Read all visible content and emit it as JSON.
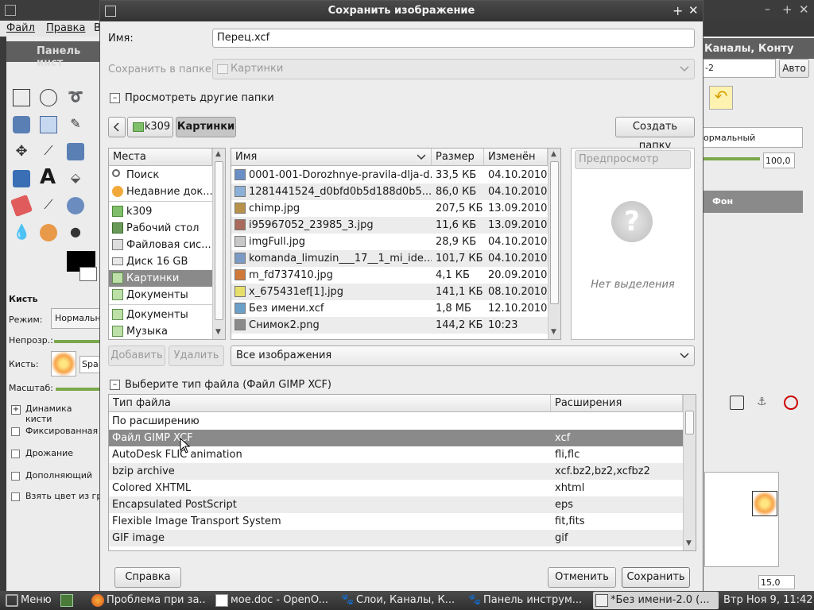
{
  "dialog": {
    "title": "Сохранить изображение",
    "name_label": "Имя:",
    "name_value": "Перец.xcf",
    "save_in_label": "Сохранить в папке",
    "save_in_value": "Картинки",
    "browse_other_label": "Просмотреть другие папки",
    "breadcrumb": [
      "k309",
      "Картинки"
    ],
    "create_folder_label": "Создать папку",
    "places": {
      "header": "Места",
      "items": [
        "Поиск",
        "Недавние док...",
        "k309",
        "Рабочий стол",
        "Файловая сис...",
        "Диск 16 GB",
        "Картинки",
        "Документы",
        "Документы",
        "Музыка"
      ]
    },
    "add_label": "Добавить",
    "remove_label": "Удалить",
    "files": {
      "columns": [
        "Имя",
        "Размер",
        "Изменён"
      ],
      "rows": [
        {
          "name": "0001-001-Dorozhnye-pravila-dlja-d...",
          "size": "33,5 КБ",
          "date": "04.10.2010"
        },
        {
          "name": "1281441524_d0bfd0b5d188d0b5...",
          "size": "86,0 КБ",
          "date": "04.10.2010"
        },
        {
          "name": "chimp.jpg",
          "size": "207,5 КБ",
          "date": "13.09.2010"
        },
        {
          "name": "i95967052_23985_3.jpg",
          "size": "11,6 КБ",
          "date": "13.09.2010"
        },
        {
          "name": "imgFull.jpg",
          "size": "28,9 КБ",
          "date": "04.10.2010"
        },
        {
          "name": "komanda_limuzin___17__1_mi_ide...",
          "size": "101,7 КБ",
          "date": "04.10.2010"
        },
        {
          "name": "m_fd737410.jpg",
          "size": "4,1 КБ",
          "date": "20.09.2010"
        },
        {
          "name": "x_675431ef[1].jpg",
          "size": "141,1 КБ",
          "date": "08.10.2010"
        },
        {
          "name": "Без имени.xcf",
          "size": "1,8 МБ",
          "date": "12.10.2010"
        },
        {
          "name": "Снимок2.png",
          "size": "144,2 КБ",
          "date": "10:23"
        }
      ]
    },
    "preview_label": "Предпросмотр",
    "no_selection": "Нет выделения",
    "filter_value": "Все изображения",
    "filetype_label": "Выберите тип файла (Файл GIMP XCF)",
    "types": {
      "columns": [
        "Тип файла",
        "Расширения"
      ],
      "rows": [
        {
          "type": "По расширению",
          "ext": ""
        },
        {
          "type": "Файл GIMP XCF",
          "ext": "xcf"
        },
        {
          "type": "AutoDesk FLIC animation",
          "ext": "fli,flc"
        },
        {
          "type": "bzip archive",
          "ext": "xcf.bz2,bz2,xcfbz2"
        },
        {
          "type": "Colored XHTML",
          "ext": "xhtml"
        },
        {
          "type": "Encapsulated PostScript",
          "ext": "eps"
        },
        {
          "type": "Flexible Image Transport System",
          "ext": "fit,fits"
        },
        {
          "type": "GIF image",
          "ext": "gif"
        }
      ]
    },
    "help_label": "Справка",
    "cancel_label": "Отменить",
    "save_label": "Сохранить"
  },
  "background": {
    "menu": [
      "Файл",
      "Правка",
      "В"
    ],
    "toolbox_title": "Панель инст",
    "right_title": "Каналы, Конту",
    "auto_label": "Авто",
    "mode_value": "ормальный",
    "opacity_value": "100,0",
    "layer_name": "Фон",
    "size_value": "15,0",
    "brush_label": "Кисть",
    "mode_label": "Режим:",
    "mode_opt": "Нормальн",
    "opacity_label": "Непрозр.:",
    "brush_row_label": "Кисть:",
    "brush_name": "Spa",
    "scale_label": "Масштаб:",
    "options": [
      "Динамика кисти",
      "Фиксированная д",
      "Дрожание",
      "Дополняющий",
      "Взять цвет из гра"
    ]
  },
  "taskbar": {
    "menu_label": "Меню",
    "tasks": [
      "Проблема при за...",
      "мое.doc - OpenO...",
      "Слои, Каналы, К...",
      "Панель инструм...",
      "*Без имени-2.0 (..."
    ],
    "clock": "Втр Ноя  9, 11:42"
  }
}
